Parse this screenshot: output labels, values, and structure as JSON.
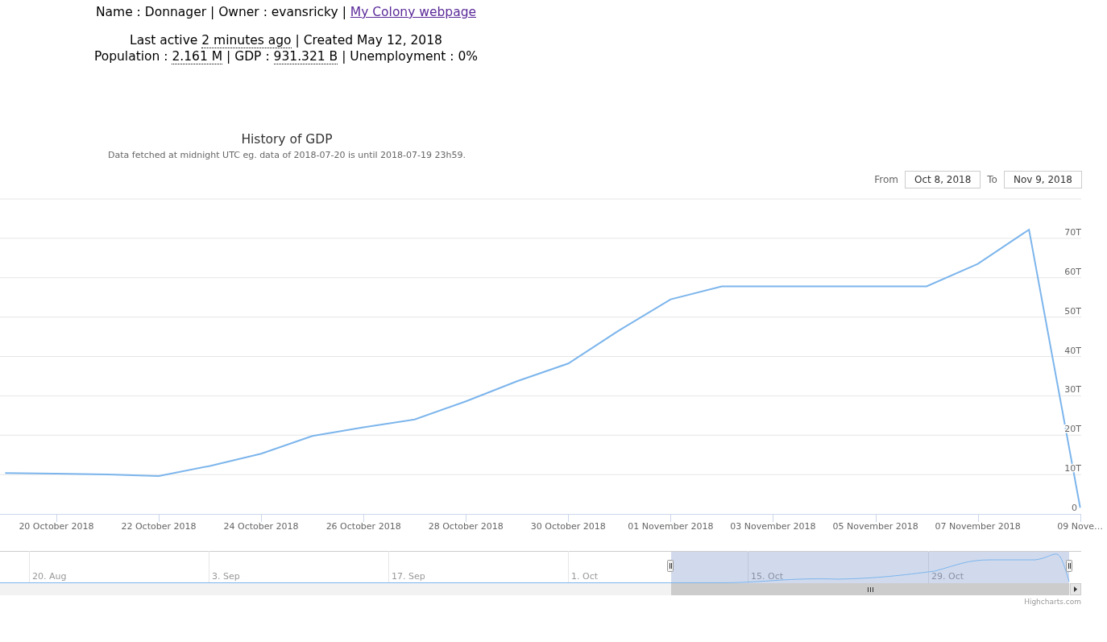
{
  "header": {
    "lines": [
      {
        "parts": [
          {
            "kind": "text",
            "text": "Name : Donnager | Owner : evansricky | "
          },
          {
            "kind": "link",
            "text": "My Colony webpage"
          }
        ]
      },
      {
        "parts": [
          {
            "kind": "text",
            "text": "Last active "
          },
          {
            "kind": "dotted",
            "text": "2 minutes ago"
          },
          {
            "kind": "text",
            "text": " | Created May 12, 2018"
          }
        ]
      },
      {
        "parts": [
          {
            "kind": "text",
            "text": "Population : "
          },
          {
            "kind": "dotted",
            "text": "2.161 M"
          },
          {
            "kind": "text",
            "text": " | GDP : "
          },
          {
            "kind": "dotted",
            "text": "931.321 B"
          },
          {
            "kind": "text",
            "text": " | Unemployment : 0%"
          }
        ]
      }
    ]
  },
  "chart": {
    "title": "History of GDP",
    "subtitle": "Data fetched at midnight UTC eg. data of 2018-07-20 is until 2018-07-19 23h59.",
    "range": {
      "from_label": "From",
      "from_value": "Oct 8, 2018",
      "to_label": "To",
      "to_value": "Nov 9, 2018"
    },
    "chart_data": {
      "type": "line",
      "categories": [
        null,
        "20 October 2018",
        null,
        "22 October 2018",
        null,
        "24 October 2018",
        null,
        "26 October 2018",
        null,
        "28 October 2018",
        null,
        "30 October 2018",
        null,
        "01 November 2018",
        null,
        "03 November 2018",
        null,
        "05 November 2018",
        null,
        "07 November 2018",
        null,
        "09 Nove…"
      ],
      "series": [
        {
          "color": "#7cb5ec",
          "values": [
            10.4,
            10.2,
            10.0,
            9.6,
            12.2,
            15.3,
            19.8,
            22.0,
            24.0,
            28.6,
            33.7,
            38.2,
            46.7,
            54.5,
            57.8,
            57.8,
            57.8,
            57.8,
            57.8,
            63.5,
            72.2,
            1.6
          ]
        }
      ],
      "ylim": [
        0,
        80
      ],
      "grid": true,
      "yticks": [
        {
          "value": 0,
          "label": "0"
        },
        {
          "value": 10,
          "label": "10T"
        },
        {
          "value": 20,
          "label": "20T"
        },
        {
          "value": 30,
          "label": "30T"
        },
        {
          "value": 40,
          "label": "40T"
        },
        {
          "value": 50,
          "label": "50T"
        },
        {
          "value": 60,
          "label": "60T"
        },
        {
          "value": 70,
          "label": "70T"
        }
      ]
    },
    "navigator": {
      "labels": [
        "20. Aug",
        "3. Sep",
        "17. Sep",
        "1. Oct",
        "15. Oct",
        "29. Oct"
      ]
    },
    "credit": "Highcharts.com"
  }
}
